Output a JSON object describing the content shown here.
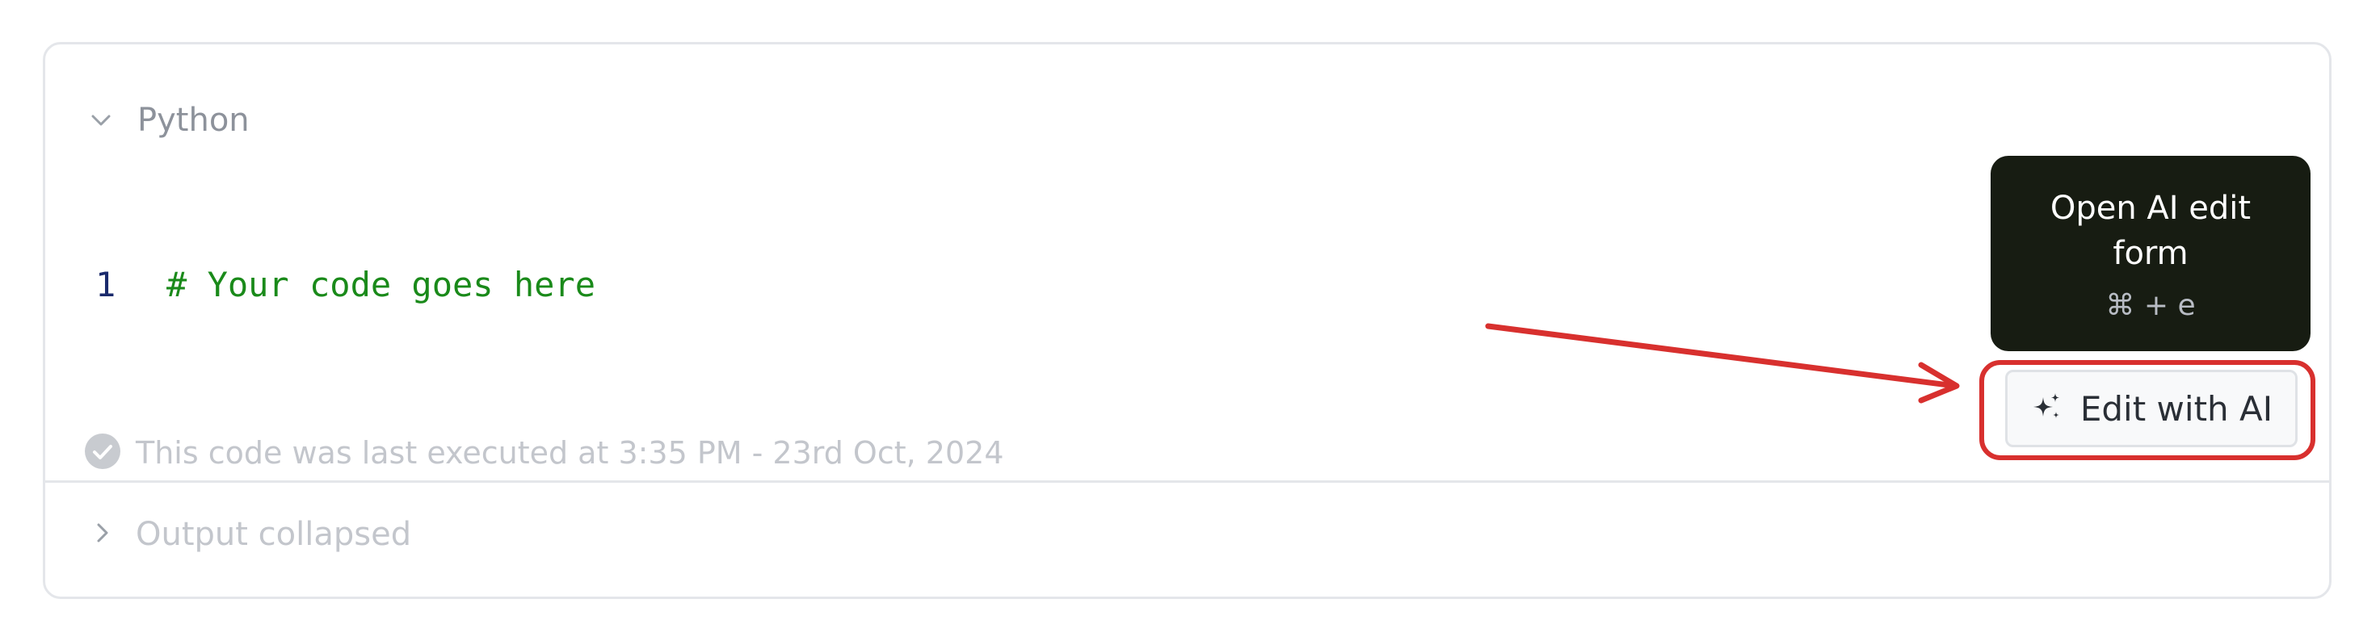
{
  "cell": {
    "language": "Python",
    "collapse_icon": "chevron-down-icon"
  },
  "code": {
    "lines": [
      {
        "number": "1",
        "text": "# Your code goes here"
      }
    ]
  },
  "execution": {
    "status_icon": "check-circle-icon",
    "status_text": "This code was last executed at 3:35 PM - 23rd Oct, 2024"
  },
  "output": {
    "expand_icon": "chevron-right-icon",
    "label": "Output collapsed"
  },
  "tooltip": {
    "title": "Open AI edit form",
    "shortcut": "⌘ + e"
  },
  "edit_button": {
    "icon": "sparkles-icon",
    "label": "Edit with AI"
  },
  "annotation": {
    "color": "#d8302e"
  }
}
